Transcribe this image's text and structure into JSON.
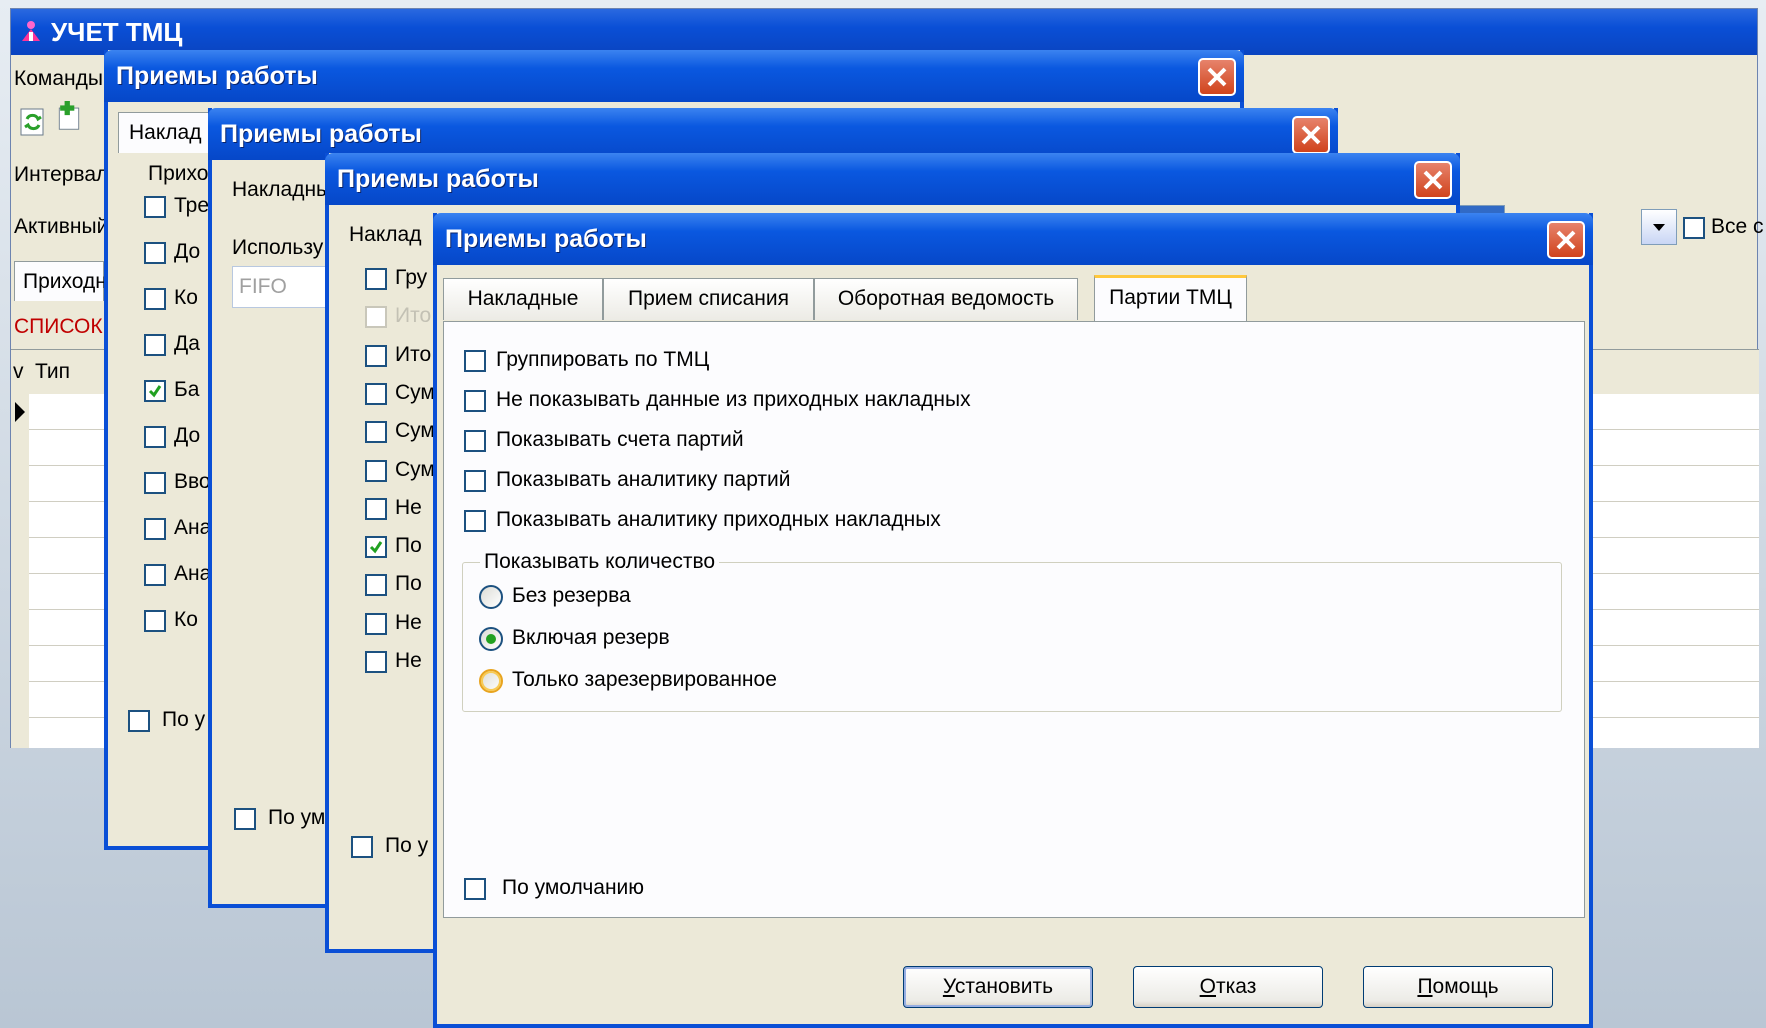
{
  "main": {
    "title": "УЧЕТ ТМЦ",
    "menu_label": "Команды",
    "interval_label": "Интервал",
    "active_label": "Активный",
    "tab_label": "Приходн",
    "list_label": "СПИСОК",
    "grid_header_v": "v",
    "grid_header_type": "Тип",
    "all_checkbox_label": "Все с"
  },
  "dialog1": {
    "title": "Приемы работы",
    "tab": "Наклад",
    "group_label": "Прихо",
    "items": [
      "Тре",
      "До",
      "Ко",
      "Да",
      "Ба",
      "До",
      "Вво",
      "Ана",
      "Ана",
      "Ко"
    ],
    "checked_index": 4,
    "default_label": "По у"
  },
  "dialog2": {
    "title": "Приемы работы",
    "tab": "Накладны",
    "use_label": "Использу",
    "fifo_value": "FIFO",
    "default_label": "По ум"
  },
  "dialog3": {
    "title": "Приемы работы",
    "tab": "Наклад",
    "items": [
      "Гру",
      "Ито",
      "Ито",
      "Сум",
      "Сум",
      "Сум",
      "Не",
      "По",
      "По",
      "Не",
      "Не"
    ],
    "disabled_index": 1,
    "checked_index": 7,
    "default_label": "По у"
  },
  "dialog4": {
    "title": "Приемы работы",
    "tabs": [
      "Накладные",
      "Прием списания",
      "Оборотная ведомость",
      "Партии ТМЦ"
    ],
    "active_tab": 3,
    "options": [
      "Группировать по ТМЦ",
      "Не показывать данные из приходных накладных",
      "Показывать счета партий",
      "Показывать аналитику партий",
      "Показывать аналитику приходных накладных"
    ],
    "qty_group_label": "Показывать количество",
    "qty_options": [
      "Без резерва",
      "Включая резерв",
      "Только зарезервированное"
    ],
    "qty_selected": 1,
    "default_label": "По умолчанию",
    "btn_set_u": "У",
    "btn_set_rest": "становить",
    "btn_cancel_u": "О",
    "btn_cancel_rest": "тказ",
    "btn_help_u": "П",
    "btn_help_rest": "омощь"
  },
  "colors": {
    "title_blue": "#0a4fd6",
    "face": "#ece9d8",
    "list_red": "#c00000"
  }
}
